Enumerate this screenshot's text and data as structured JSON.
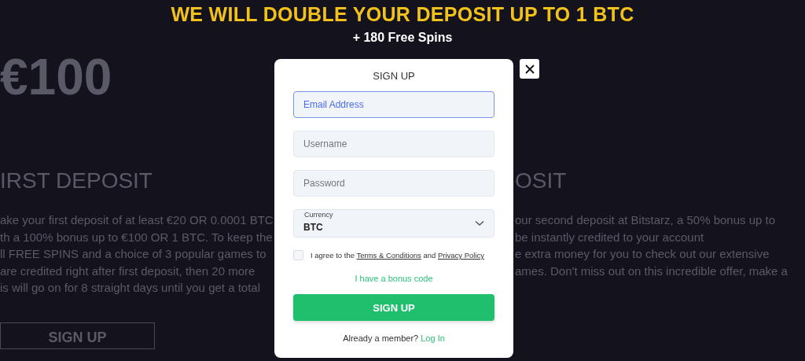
{
  "headline": "WE WILL DOUBLE YOUR DEPOSIT UP TO 1 BTC",
  "subheadline": "+ 180 Free Spins",
  "background": {
    "amount": "€100",
    "left_heading": "IRST DEPOSIT",
    "right_heading": "OSIT",
    "left_lines": [
      "ake your first deposit of at least €20 OR 0.0001 BTC",
      "th a 100% bonus up to €100 OR 1 BTC. To keep the",
      "ll FREE SPINS and a choice of 3 popular games to",
      "are credited right after first deposit, then 20 more",
      "is will go on for 8 straight days until you get a total"
    ],
    "right_lines": [
      "our second deposit at Bitstarz, a 50% bonus up to",
      "be instantly credited to your account",
      "e extra money for you to check out our extensive",
      "ames. Don't miss out on this incredible offer, make a"
    ],
    "button": "SIGN UP"
  },
  "modal": {
    "title": "SIGN UP",
    "fields": [
      {
        "kind": "text",
        "placeholder": "Email Address",
        "focused": true
      },
      {
        "kind": "text",
        "placeholder": "Username",
        "focused": false
      },
      {
        "kind": "text",
        "placeholder": "Password",
        "focused": false
      },
      {
        "kind": "select",
        "label": "Currency",
        "value": "BTC",
        "focused": false
      }
    ],
    "agree": {
      "checked": false,
      "prefix": "I agree to the",
      "terms": "Terms & Conditions",
      "middle": "and",
      "privacy": "Privacy Policy"
    },
    "bonus_link": "I have a bonus code",
    "submit": "SIGN UP",
    "member_text": "Already a member?",
    "login_link": "Log In"
  }
}
